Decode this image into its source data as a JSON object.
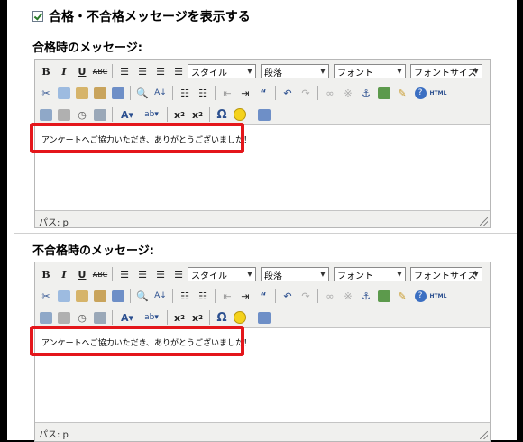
{
  "checkbox": {
    "label": "合格・不合格メッセージを表示する",
    "checked": true
  },
  "sections": [
    {
      "title": "合格時のメッセージ:",
      "toolbar": {
        "style": "スタイル",
        "paragraph": "段落",
        "font": "フォント",
        "font_size": "フォントサイズ"
      },
      "message": "アンケートへご協力いただき、ありがとうございました！",
      "status": "パス: p"
    },
    {
      "title": "不合格時のメッセージ:",
      "toolbar": {
        "style": "スタイル",
        "paragraph": "段落",
        "font": "フォント",
        "font_size": "フォントサイズ"
      },
      "message": "アンケートへご協力いただき、ありがとうございました！",
      "status": "パス: p"
    }
  ],
  "icons": [
    "bold-icon",
    "italic-icon",
    "underline-icon",
    "strikethrough-icon",
    "align-left-icon",
    "align-center-icon",
    "align-right-icon",
    "align-justify-icon",
    "cut-icon",
    "copy-icon",
    "paste-icon",
    "paste-text-icon",
    "paste-word-icon",
    "find-icon",
    "replace-icon",
    "bullet-list-icon",
    "numbered-list-icon",
    "outdent-icon",
    "indent-icon",
    "blockquote-icon",
    "undo-icon",
    "redo-icon",
    "link-icon",
    "unlink-icon",
    "anchor-icon",
    "image-icon",
    "cleanup-icon",
    "help-icon",
    "html-icon",
    "edit-icon",
    "date-icon",
    "time-icon",
    "preview-icon",
    "font-color-icon",
    "highlight-icon",
    "subscript-icon",
    "superscript-icon",
    "special-char-icon",
    "emoticon-icon",
    "fullscreen-icon"
  ],
  "colors": {
    "highlight_box": "#e4161b",
    "editor_bg": "#f0f0ee"
  }
}
